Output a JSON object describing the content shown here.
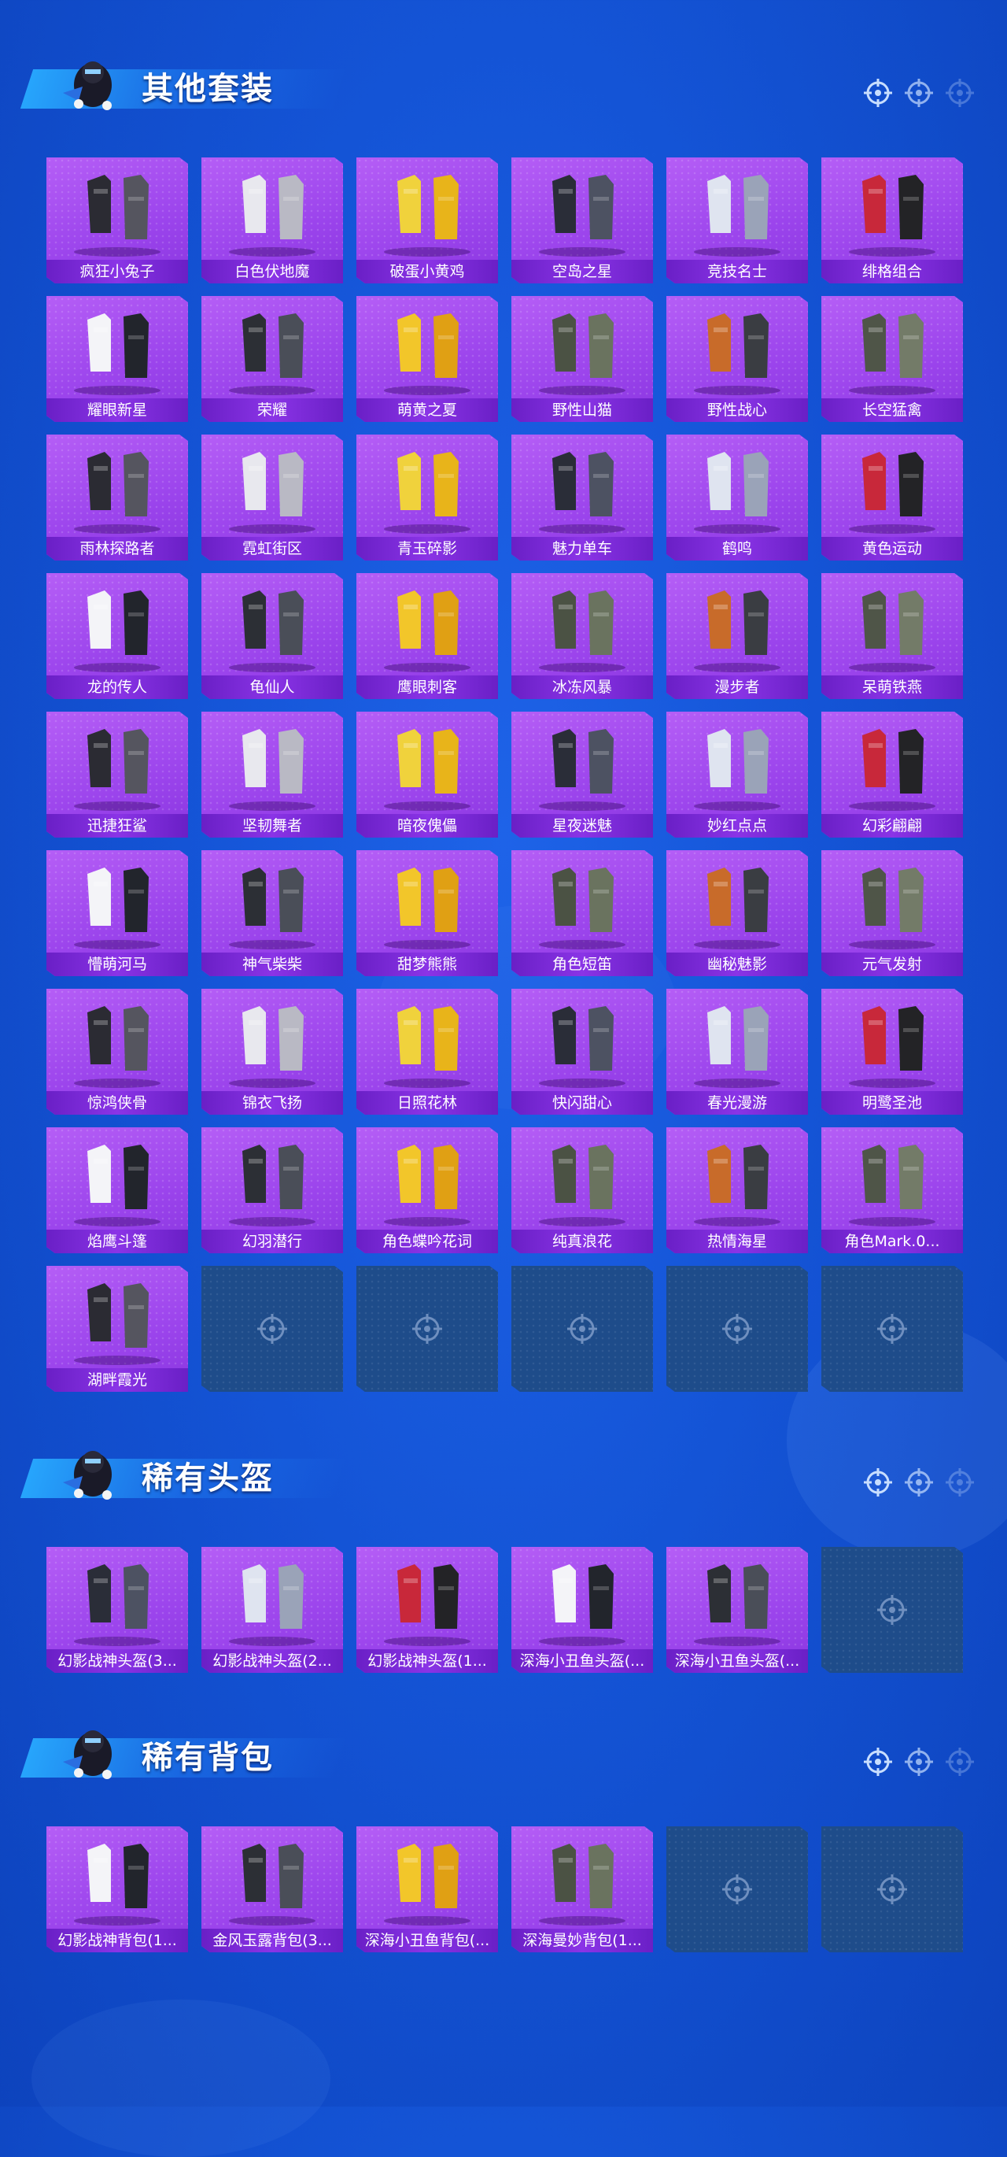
{
  "colors": {
    "background": "#1454d6",
    "card_purple": "#a24cf0",
    "label_bar": "#6a1fc6",
    "empty_slot": "#1e4c8a",
    "banner_accent": "#28aaff"
  },
  "sections": [
    {
      "title": "其他套装",
      "items": [
        {
          "name": "疯狂小兔子",
          "icon": "pink-bunny-outfit-icon"
        },
        {
          "name": "白色伏地魔",
          "icon": "white-hoodie-outfit-icon"
        },
        {
          "name": "破蛋小黄鸡",
          "icon": "yellow-chick-outfit-icon"
        },
        {
          "name": "空岛之星",
          "icon": "dark-duo-outfit-icon"
        },
        {
          "name": "竞技名士",
          "icon": "white-jacket-outfit-icon"
        },
        {
          "name": "绯格组合",
          "icon": "red-plaid-set-icon"
        },
        {
          "name": "耀眼新星",
          "icon": "white-shirt-outfit-icon"
        },
        {
          "name": "荣耀",
          "icon": "dark-jacket-outfit-icon"
        },
        {
          "name": "萌黄之夏",
          "icon": "yellow-summer-set-icon"
        },
        {
          "name": "野性山猫",
          "icon": "camo-jacket-outfit-icon"
        },
        {
          "name": "野性战心",
          "icon": "orange-vest-outfit-icon"
        },
        {
          "name": "长空猛禽",
          "icon": "camo-pilot-outfit-icon"
        },
        {
          "name": "雨林探路者",
          "icon": "green-jacket-outfit-icon"
        },
        {
          "name": "霓虹街区",
          "icon": "neon-street-set-icon"
        },
        {
          "name": "青玉碎影",
          "icon": "jade-outfit-set-icon"
        },
        {
          "name": "魅力单车",
          "icon": "yellow-tee-outfit-icon"
        },
        {
          "name": "鹤鸣",
          "icon": "crane-hoodie-icon"
        },
        {
          "name": "黄色运动",
          "icon": "yellow-sport-jacket-icon"
        },
        {
          "name": "龙的传人",
          "icon": "red-dragon-robe-icon"
        },
        {
          "name": "龟仙人",
          "icon": "hawaiian-shirt-icon"
        },
        {
          "name": "鹰眼刺客",
          "icon": "black-assassin-outfit-icon"
        },
        {
          "name": "冰冻风暴",
          "icon": "hooded-storm-outfit-icon"
        },
        {
          "name": "漫步者",
          "icon": "black-trench-outfit-icon"
        },
        {
          "name": "呆萌铁燕",
          "icon": "bear-mask-set-icon"
        },
        {
          "name": "迅捷狂鲨",
          "icon": "shark-set-icon"
        },
        {
          "name": "坚韧舞者",
          "icon": "white-dancer-set-icon"
        },
        {
          "name": "暗夜傀儡",
          "icon": "night-puppet-set-icon"
        },
        {
          "name": "星夜迷魅",
          "icon": "starry-night-set-icon"
        },
        {
          "name": "妙红点点",
          "icon": "red-dots-set-icon"
        },
        {
          "name": "幻彩翩翩",
          "icon": "pastel-dress-set-icon"
        },
        {
          "name": "懵萌河马",
          "icon": "hippo-pajama-set-icon"
        },
        {
          "name": "神气柴柴",
          "icon": "shiba-set-icon"
        },
        {
          "name": "甜梦熊熊",
          "icon": "dream-bear-set-icon"
        },
        {
          "name": "角色短笛",
          "icon": "piccolo-character-icon"
        },
        {
          "name": "幽秘魅影",
          "icon": "dark-phantom-set-icon"
        },
        {
          "name": "元气发射",
          "icon": "energy-launch-set-icon"
        },
        {
          "name": "惊鸿侠骨",
          "icon": "hanfu-warrior-set-icon"
        },
        {
          "name": "锦衣飞扬",
          "icon": "white-robe-set-icon"
        },
        {
          "name": "日照花林",
          "icon": "pink-flower-dress-set-icon"
        },
        {
          "name": "快闪甜心",
          "icon": "heart-jacket-set-icon"
        },
        {
          "name": "春光漫游",
          "icon": "spring-outing-set-icon"
        },
        {
          "name": "明鹭圣池",
          "icon": "heron-gown-set-icon"
        },
        {
          "name": "焰鹰斗篷",
          "icon": "flame-hawk-cloak-icon"
        },
        {
          "name": "幻羽潜行",
          "icon": "green-shadow-set-icon"
        },
        {
          "name": "角色蝶吟花词",
          "icon": "butterfly-character-icon"
        },
        {
          "name": "纯真浪花",
          "icon": "wave-set-icon"
        },
        {
          "name": "热情海星",
          "icon": "starfish-set-icon"
        },
        {
          "name": "角色Mark.0...",
          "icon": "mecha-character-icon"
        },
        {
          "name": "湖畔霞光",
          "icon": "lakeside-dress-set-icon"
        }
      ],
      "empty_slots": 5
    },
    {
      "title": "稀有头盔",
      "items": [
        {
          "name": "幻影战神头盔(3...",
          "icon": "phantom-helmet-lv3-icon"
        },
        {
          "name": "幻影战神头盔(2...",
          "icon": "phantom-helmet-lv2-icon"
        },
        {
          "name": "幻影战神头盔(1...",
          "icon": "phantom-helmet-lv1-icon"
        },
        {
          "name": "深海小丑鱼头盔(...",
          "icon": "clownfish-helmet-icon"
        },
        {
          "name": "深海小丑鱼头盔(...",
          "icon": "clownfish-helmet-alt-icon"
        }
      ],
      "empty_slots": 1
    },
    {
      "title": "稀有背包",
      "items": [
        {
          "name": "幻影战神背包(1...",
          "icon": "phantom-backpack-icon"
        },
        {
          "name": "金风玉露背包(3...",
          "icon": "golden-wind-backpack-icon"
        },
        {
          "name": "深海小丑鱼背包(...",
          "icon": "clownfish-backpack-icon"
        },
        {
          "name": "深海曼妙背包(1...",
          "icon": "deep-sea-backpack-icon"
        }
      ],
      "empty_slots": 2
    }
  ]
}
